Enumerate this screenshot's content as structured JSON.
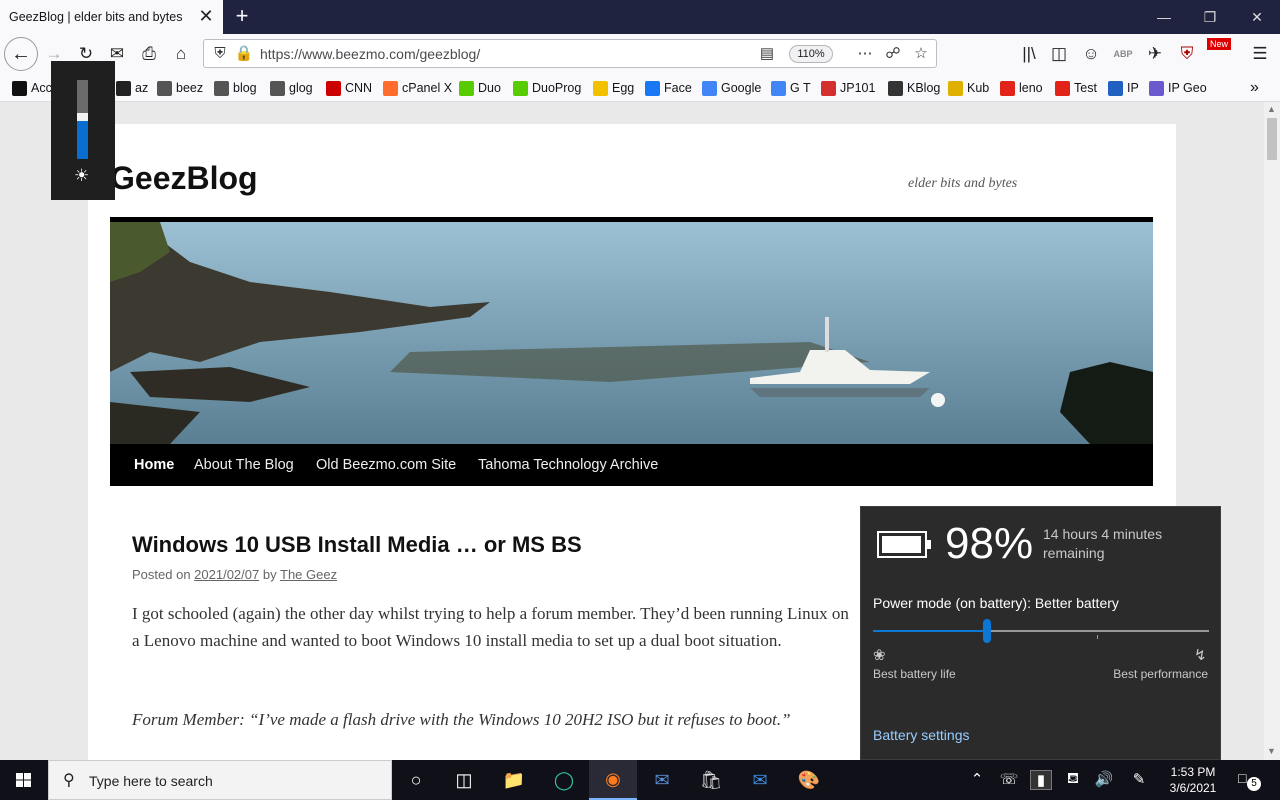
{
  "browser": {
    "tab_title": "GeezBlog | elder bits and bytes",
    "tab_close": "✕",
    "new_tab": "+",
    "url": "https://www.beezmo.com/geezblog/",
    "zoom": "110%",
    "accent_color": "#202340"
  },
  "bookmarks": [
    {
      "label": "Acc",
      "icon": "x-icon",
      "color": "#111"
    },
    {
      "label": "az",
      "icon": "amazon-icon",
      "color": "#222"
    },
    {
      "label": "beez",
      "icon": "globe-icon",
      "color": "#555"
    },
    {
      "label": "blog",
      "icon": "globe-icon",
      "color": "#555"
    },
    {
      "label": "glog",
      "icon": "globe-icon",
      "color": "#555"
    },
    {
      "label": "CNN",
      "icon": "cnn-icon",
      "color": "#cc0000"
    },
    {
      "label": "cPanel X",
      "icon": "cpanel-icon",
      "color": "#ff6c2c"
    },
    {
      "label": "Duo",
      "icon": "duolingo-icon",
      "color": "#58cc02"
    },
    {
      "label": "DuoProg",
      "icon": "duolingo-icon",
      "color": "#58cc02"
    },
    {
      "label": "Egg",
      "icon": "egg-icon",
      "color": "#f2c200"
    },
    {
      "label": "Face",
      "icon": "facebook-icon",
      "color": "#1877f2"
    },
    {
      "label": "Google",
      "icon": "google-icon",
      "color": "#4285f4"
    },
    {
      "label": "G T",
      "icon": "translate-icon",
      "color": "#4285f4"
    },
    {
      "label": "JP101",
      "icon": "jp101-icon",
      "color": "#d32f2f"
    },
    {
      "label": "KBlog",
      "icon": "tux-icon",
      "color": "#333"
    },
    {
      "label": "Kub",
      "icon": "kub-icon",
      "color": "#e0b000"
    },
    {
      "label": "leno",
      "icon": "lenovo-icon",
      "color": "#e2231a"
    },
    {
      "label": "Test",
      "icon": "lenovo-icon",
      "color": "#e2231a"
    },
    {
      "label": "IP",
      "icon": "ip-icon",
      "color": "#2060c0"
    },
    {
      "label": "IP Geo",
      "icon": "location-icon",
      "color": "#6a5acd"
    }
  ],
  "site": {
    "title": "GeezBlog",
    "description": "elder bits and bytes",
    "nav": [
      "Home",
      "About The Blog",
      "Old Beezmo.com Site",
      "Tahoma Technology Archive"
    ]
  },
  "post": {
    "title": "Windows 10 USB Install Media … or MS BS",
    "posted_on_label": "Posted on",
    "date": "2021/02/07",
    "by_label": "by",
    "author": "The Geez",
    "para1": "I got schooled (again) the other day whilst trying to help a forum member.  They’d been running Linux on a Lenovo machine and wanted to boot Windows 10 install media to set up a dual boot situation.",
    "para2": "Forum Member: “I’ve made a flash drive with the Windows 10 20H2 ISO but it refuses to boot.”"
  },
  "brightness": {
    "level": 0.48,
    "icon": "sun-icon"
  },
  "battery": {
    "percent": "98%",
    "level": 0.98,
    "remaining": "14 hours 4 minutes remaining",
    "power_mode_label": "Power mode (on battery): Better battery",
    "slider_value": 0.34,
    "best_battery_label": "Best battery life",
    "best_performance_label": "Best performance",
    "settings_link": "Battery settings",
    "accent_color": "#0a78d4"
  },
  "taskbar": {
    "search_placeholder": "Type here to search",
    "time": "1:53 PM",
    "date": "3/6/2021",
    "notification_count": "5"
  }
}
